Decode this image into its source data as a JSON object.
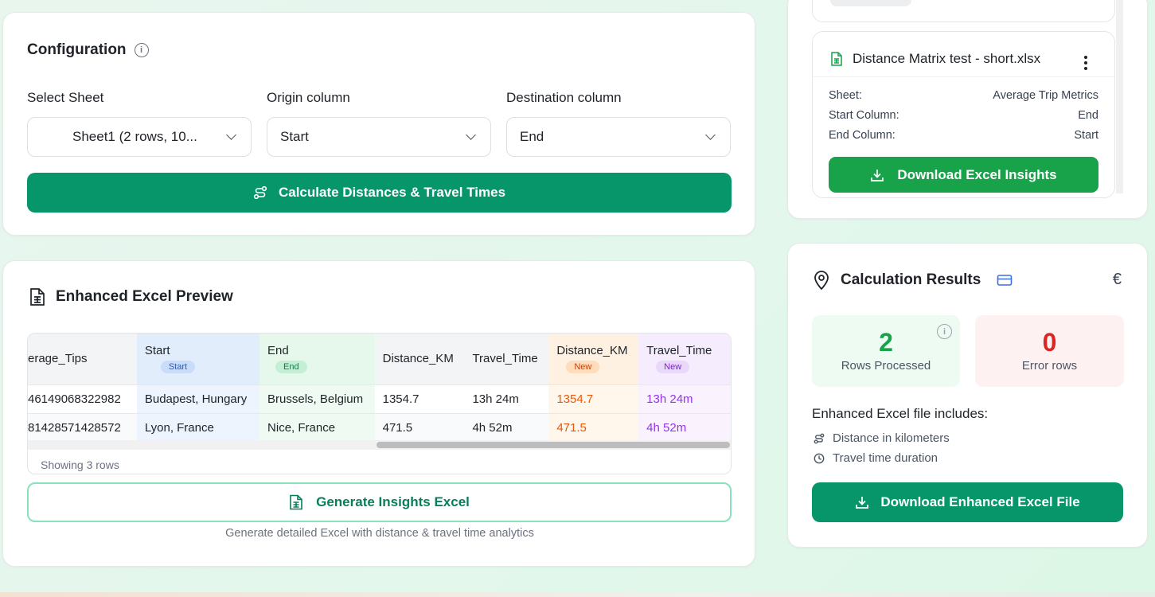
{
  "config": {
    "title": "Configuration",
    "select_sheet_label": "Select Sheet",
    "select_sheet_value": "Sheet1 (2 rows, 10...",
    "origin_label": "Origin column",
    "origin_value": "Start",
    "destination_label": "Destination column",
    "destination_value": "End",
    "calculate_button": "Calculate Distances & Travel Times"
  },
  "preview": {
    "title": "Enhanced Excel Preview",
    "columns": [
      {
        "label": "erage_Tips",
        "badge": ""
      },
      {
        "label": "Start",
        "badge": "Start"
      },
      {
        "label": "End",
        "badge": "End"
      },
      {
        "label": "Distance_KM",
        "badge": ""
      },
      {
        "label": "Travel_Time",
        "badge": ""
      },
      {
        "label": "Distance_KM",
        "badge": "New"
      },
      {
        "label": "Travel_Time",
        "badge": "New"
      }
    ],
    "rows": [
      [
        "46149068322982",
        "Budapest, Hungary",
        "Brussels, Belgium",
        "1354.7",
        "13h 24m",
        "1354.7",
        "13h 24m"
      ],
      [
        "81428571428572",
        "Lyon, France",
        "Nice, France",
        "471.5",
        "4h 52m",
        "471.5",
        "4h 52m"
      ]
    ],
    "showing": "Showing 3 rows",
    "generate_button": "Generate Insights Excel",
    "generate_caption": "Generate detailed Excel with distance & travel time analytics"
  },
  "history": {
    "file_name": "Distance Matrix test - short.xlsx",
    "sheet_label": "Sheet:",
    "sheet_value": "Average Trip Metrics",
    "start_label": "Start Column:",
    "start_value": "End",
    "end_label": "End Column:",
    "end_value": "Start",
    "download_button": "Download Excel Insights"
  },
  "results": {
    "title": "Calculation Results",
    "currency_symbol": "€",
    "rows_processed_value": "2",
    "rows_processed_label": "Rows Processed",
    "error_value": "0",
    "error_label": "Error rows",
    "includes_title": "Enhanced Excel file includes:",
    "feature_distance": "Distance in kilometers",
    "feature_time": "Travel time duration",
    "download_button": "Download Enhanced Excel File"
  },
  "colors": {
    "primary_green": "#07966a",
    "bright_green": "#18a34a",
    "start_col_bg": "#e2edfc",
    "end_col_bg": "#e6f8ec",
    "new_distance_bg": "#fff1e2",
    "new_time_bg": "#f5ecfd",
    "error_red": "#dc2626"
  }
}
